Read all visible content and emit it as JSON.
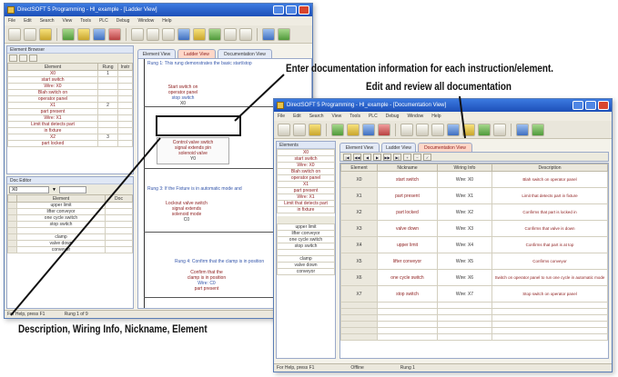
{
  "back_window": {
    "title": "DirectSOFT 5 Programming - HI_example - [Ladder View]",
    "menu": [
      "File",
      "Edit",
      "Search",
      "View",
      "Tools",
      "PLC",
      "Debug",
      "Window",
      "Help"
    ],
    "element_panel": {
      "headers": [
        "Element",
        "Rung",
        "Instr"
      ],
      "rows": [
        {
          "element": "X0",
          "rung": "1",
          "instr": ""
        },
        {
          "element": "start switch",
          "rung": "",
          "instr": ""
        },
        {
          "element": "Wire: X0",
          "rung": "",
          "instr": ""
        },
        {
          "element": "Blah switch on",
          "rung": "",
          "instr": ""
        },
        {
          "element": "operator panel",
          "rung": "",
          "instr": ""
        },
        {
          "element": "X1",
          "rung": "2",
          "instr": ""
        },
        {
          "element": "part present",
          "rung": "",
          "instr": ""
        },
        {
          "element": "Wire: X1",
          "rung": "",
          "instr": ""
        },
        {
          "element": "Limit that detects part",
          "rung": "",
          "instr": ""
        },
        {
          "element": "in fixture",
          "rung": "",
          "instr": ""
        },
        {
          "element": "X2",
          "rung": "3",
          "instr": ""
        },
        {
          "element": "part locked",
          "rung": "",
          "instr": ""
        }
      ]
    },
    "lower_panel": {
      "title": "Doc Editor",
      "dropdown_value": "X0",
      "headers": [
        "Element",
        "Doc"
      ],
      "rows": [
        "upper limit",
        "lifter conveyor",
        "one cycle switch",
        "stop switch",
        "",
        "clamp",
        "valve down",
        "conveyor"
      ]
    },
    "tabs": [
      "Element View",
      "Ladder View",
      "Documentation View"
    ],
    "active_tab_index": 1,
    "rungs": [
      {
        "comment": "Rung 1: This rung demonstrates the basic start/stop",
        "labels": [
          "Start switch on",
          "operator panel",
          "stop switch",
          "X0"
        ]
      },
      {
        "comment": "Rung 2: If the part is in place",
        "labels": [
          "Control valve switch",
          "signal extends pin",
          "solenoid valve",
          "Y0"
        ]
      },
      {
        "comment": "Rung 3: If the Fixture is in automatic mode and",
        "labels": [
          "Lockout valve switch",
          "signal extends",
          "solenoid mode",
          "C0"
        ]
      },
      {
        "comment": "Rung 4: Confirm that the clamp is in position",
        "labels": [
          "Confirm that the",
          "clamp is in position",
          "Wire: C0",
          "part present"
        ]
      }
    ],
    "status": [
      "For Help, press F1",
      "Rung 1 of 9"
    ]
  },
  "front_window": {
    "title": "DirectSOFT 5 Programming - HI_example - [Documentation View]",
    "menu": [
      "File",
      "Edit",
      "Search",
      "View",
      "Tools",
      "PLC",
      "Debug",
      "Window",
      "Help"
    ],
    "tabs": [
      "Element View",
      "Ladder View",
      "Documentation View"
    ],
    "active_tab_index": 2,
    "nav_buttons": [
      "|◀",
      "◀◀",
      "◀",
      "▶",
      "▶▶",
      "▶|",
      "+",
      "−",
      "✓"
    ],
    "doc_headers": [
      "Element",
      "Nickname",
      "Wiring Info",
      "Description"
    ],
    "doc_rows": [
      {
        "element": "X0",
        "nickname": "start switch",
        "wiring": "Wire: X0",
        "desc": "Blah switch on operator panel"
      },
      {
        "element": "X1",
        "nickname": "part present",
        "wiring": "Wire: X1",
        "desc": "Limit that detects part in fixture"
      },
      {
        "element": "X2",
        "nickname": "part locked",
        "wiring": "Wire: X2",
        "desc": "Confirms that part is locked in"
      },
      {
        "element": "X3",
        "nickname": "valve down",
        "wiring": "Wire: X3",
        "desc": "Confirms that valve is down"
      },
      {
        "element": "X4",
        "nickname": "upper limit",
        "wiring": "Wire: X4",
        "desc": "Confirms that part is at top"
      },
      {
        "element": "X5",
        "nickname": "lifter conveyor",
        "wiring": "Wire: X5",
        "desc": "Confirms conveyor"
      },
      {
        "element": "X6",
        "nickname": "one cycle switch",
        "wiring": "Wire: X6",
        "desc": "Switch on operator panel to run one cycle in automatic mode"
      },
      {
        "element": "X7",
        "nickname": "stop switch",
        "wiring": "Wire: X7",
        "desc": "Stop switch on operator panel"
      }
    ],
    "left_panel_rows": [
      "X0",
      "start switch",
      "Wire: X0",
      "Blah switch on",
      "operator panel",
      "X1",
      "part present",
      "Wire: X1",
      "Limit that detects part",
      "in fixture"
    ],
    "left_lower_rows": [
      "upper limit",
      "lifter conveyor",
      "one cycle switch",
      "stop switch",
      "",
      "clamp",
      "valve down",
      "conveyor"
    ],
    "status": [
      "For Help, press F1",
      "Offline",
      "Rung 1"
    ]
  },
  "callouts": {
    "top_line1": "Enter documentation information for each instruction/element.",
    "top_line2": "Edit and review all documentation",
    "bottom": "Description, Wiring Info, Nickname, Element"
  }
}
